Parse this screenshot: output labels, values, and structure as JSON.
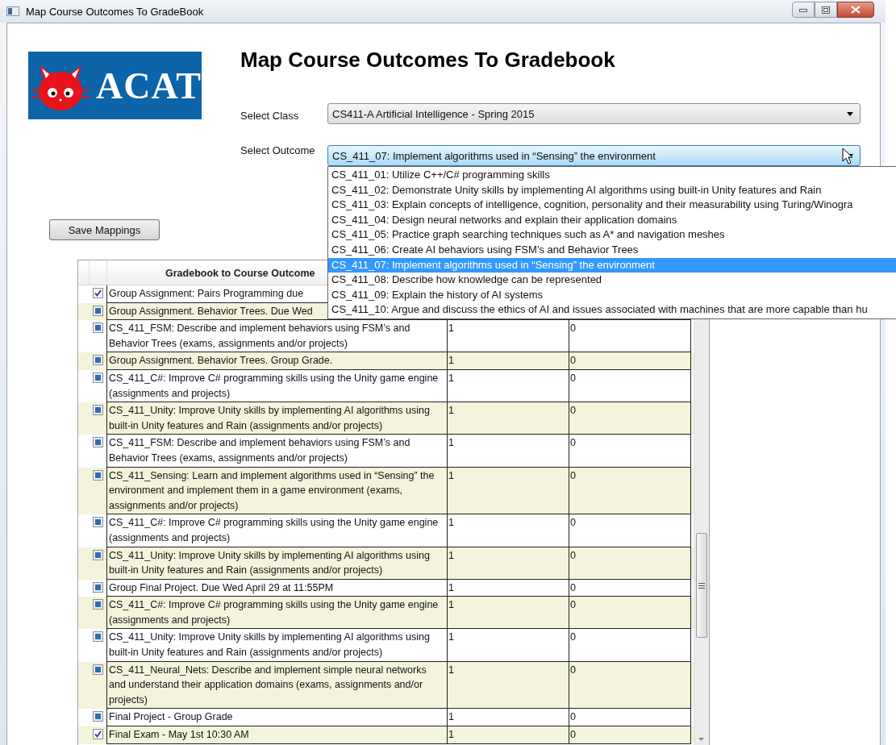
{
  "window": {
    "title": "Map Course Outcomes To GradeBook"
  },
  "logo": {
    "text": "ACAT"
  },
  "heading": "Map Course Outcomes To Gradebook",
  "class_select": {
    "label": "Select Class",
    "value": "CS411-A Artificial Intelligence - Spring 2015"
  },
  "outcome_select": {
    "label": "Select Outcome",
    "value": "CS_411_07: Implement algorithms used in “Sensing” the environment",
    "expanded": true,
    "options": [
      {
        "text": "CS_411_01: Utilize C++/C# programming skills",
        "selected": false
      },
      {
        "text": "CS_411_02: Demonstrate Unity skills by implementing AI algorithms using built-in Unity features and Rain",
        "selected": false
      },
      {
        "text": "CS_411_03: Explain concepts of intelligence, cognition, personality and their measurability using Turing/Winogra",
        "selected": false
      },
      {
        "text": "CS_411_04: Design neural networks and explain their application domains",
        "selected": false
      },
      {
        "text": "CS_411_05: Practice graph searching techniques such as A* and navigation meshes",
        "selected": false
      },
      {
        "text": "CS_411_06: Create AI behaviors using FSM’s and Behavior Trees",
        "selected": false
      },
      {
        "text": "CS_411_07: Implement algorithms used in “Sensing” the environment",
        "selected": true
      },
      {
        "text": "CS_411_08: Describe how knowledge can be represented",
        "selected": false
      },
      {
        "text": "CS_411_09: Explain the history of AI systems",
        "selected": false
      },
      {
        "text": "CS_411_10: Argue and discuss the ethics of AI and issues associated with machines that are more capable than hu",
        "selected": false
      }
    ]
  },
  "save_button": "Save Mappings",
  "grid": {
    "columns": [
      {
        "label": "Gradebook to Course Outcome"
      }
    ],
    "rows": [
      {
        "text": "Group Assignment: Pairs Programming due ",
        "checked": true,
        "indeterminate": false,
        "cells": []
      },
      {
        "text": "Group Assignment. Behavior Trees. Due Wed",
        "checked": false,
        "indeterminate": true,
        "cells": []
      },
      {
        "text": "CS_411_FSM: Describe and implement behaviors using FSM’s and Behavior Trees (exams, assignments and/or projects)",
        "checked": false,
        "indeterminate": true,
        "cells": [
          "1",
          "0"
        ]
      },
      {
        "text": "Group Assignment. Behavior Trees.  Group Grade.",
        "checked": false,
        "indeterminate": true,
        "cells": [
          "1",
          "0"
        ]
      },
      {
        "text": "CS_411_C#: Improve C# programming skills using the Unity game engine (assignments and projects)",
        "checked": false,
        "indeterminate": true,
        "cells": [
          "1",
          "0"
        ]
      },
      {
        "text": "CS_411_Unity: Improve Unity skills by implementing AI algorithms using built-in Unity features and Rain (assignments and/or projects)",
        "checked": false,
        "indeterminate": true,
        "cells": [
          "1",
          "0"
        ]
      },
      {
        "text": "CS_411_FSM: Describe and implement behaviors using FSM’s and Behavior Trees (exams, assignments and/or projects)",
        "checked": false,
        "indeterminate": true,
        "cells": [
          "1",
          "0"
        ]
      },
      {
        "text": "CS_411_Sensing: Learn and implement algorithms used in “Sensing” the environment and implement them in a game environment (exams, assignments and/or projects)",
        "checked": false,
        "indeterminate": true,
        "cells": [
          "1",
          "0"
        ]
      },
      {
        "text": "CS_411_C#: Improve C# programming skills using the Unity game engine (assignments and projects)",
        "checked": false,
        "indeterminate": true,
        "cells": [
          "1",
          "0"
        ]
      },
      {
        "text": "CS_411_Unity: Improve Unity skills by implementing AI algorithms using built-in Unity features and Rain (assignments and/or projects)",
        "checked": false,
        "indeterminate": true,
        "cells": [
          "1",
          "0"
        ]
      },
      {
        "text": "Group Final Project. Due Wed April 29 at 11:55PM",
        "checked": false,
        "indeterminate": true,
        "cells": [
          "1",
          "0"
        ]
      },
      {
        "text": "CS_411_C#: Improve C# programming skills using the Unity game engine (assignments and projects)",
        "checked": false,
        "indeterminate": true,
        "cells": [
          "1",
          "0"
        ]
      },
      {
        "text": "CS_411_Unity: Improve Unity skills by implementing AI algorithms using built-in Unity features and Rain (assignments and/or projects)",
        "checked": false,
        "indeterminate": true,
        "cells": [
          "1",
          "0"
        ]
      },
      {
        "text": "CS_411_Neural_Nets: Describe and implement simple neural networks and understand their application domains (exams, assignments and/or projects)",
        "checked": false,
        "indeterminate": true,
        "cells": [
          "1",
          "0"
        ]
      },
      {
        "text": "Final Project - Group Grade",
        "checked": false,
        "indeterminate": true,
        "cells": [
          "1",
          "0"
        ]
      },
      {
        "text": "Final Exam - May 1st 10:30 AM",
        "checked": true,
        "indeterminate": false,
        "cells": [
          "1",
          "0"
        ]
      }
    ]
  }
}
